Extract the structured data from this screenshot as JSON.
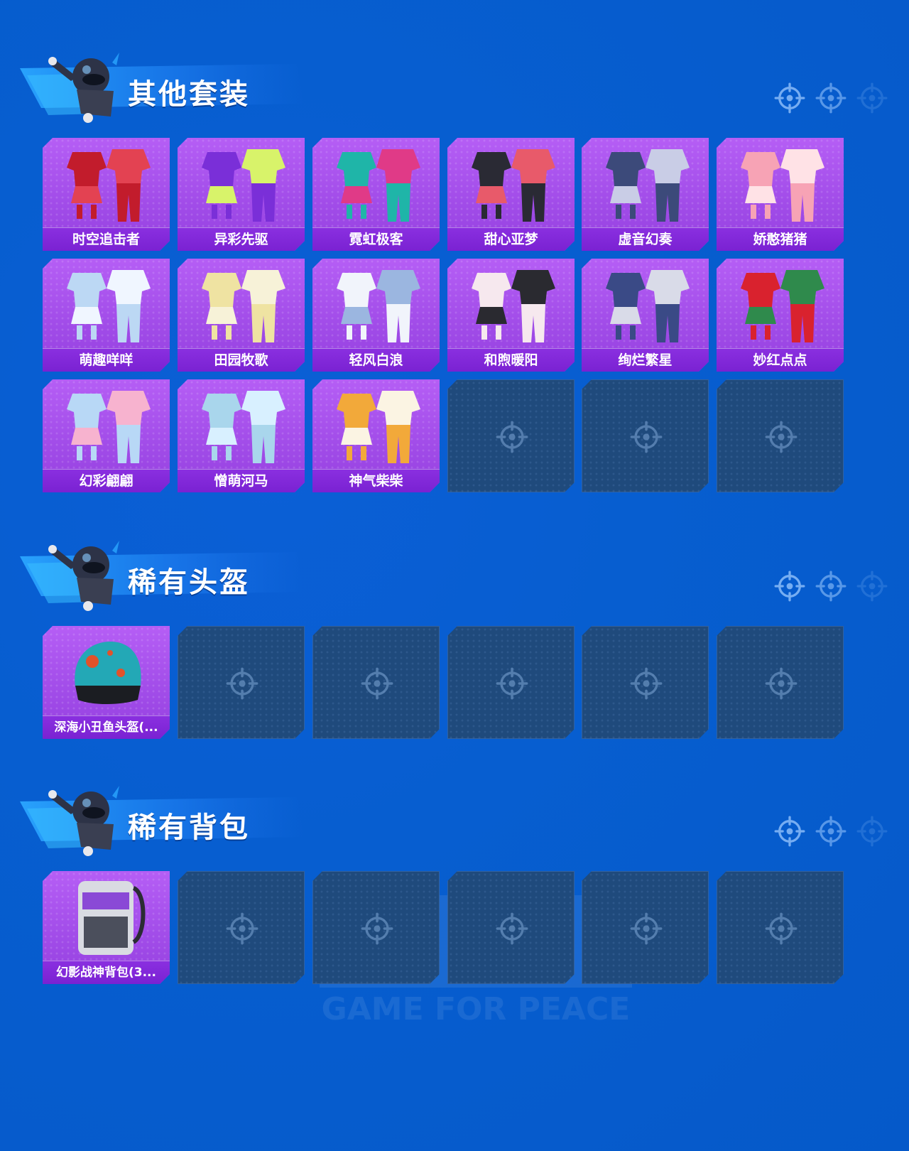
{
  "sections": [
    {
      "title": "其他套装",
      "items": [
        {
          "label": "时空追击者",
          "icon": "suit-outfit-icon",
          "colors": [
            "#c21c2c",
            "#e34252"
          ]
        },
        {
          "label": "异彩先驱",
          "icon": "suit-outfit-icon",
          "colors": [
            "#7a2fd8",
            "#d8f36a"
          ]
        },
        {
          "label": "霓虹极客",
          "icon": "suit-outfit-icon",
          "colors": [
            "#1fb5a8",
            "#e03a87"
          ]
        },
        {
          "label": "甜心亚梦",
          "icon": "suit-outfit-icon",
          "colors": [
            "#2a2a34",
            "#e85a6a"
          ]
        },
        {
          "label": "虚音幻奏",
          "icon": "suit-outfit-icon",
          "colors": [
            "#3c4a7a",
            "#c9cde6"
          ]
        },
        {
          "label": "娇憨猪猪",
          "icon": "suit-outfit-icon",
          "colors": [
            "#f7a3b5",
            "#ffe2e6"
          ]
        },
        {
          "label": "萌趣咩咩",
          "icon": "suit-outfit-icon",
          "colors": [
            "#bcd8f4",
            "#f0f6ff"
          ]
        },
        {
          "label": "田园牧歌",
          "icon": "suit-outfit-icon",
          "colors": [
            "#efe3a2",
            "#f7f2d8"
          ]
        },
        {
          "label": "轻风白浪",
          "icon": "suit-outfit-icon",
          "colors": [
            "#f1f4fb",
            "#9bb6e0"
          ]
        },
        {
          "label": "和煦暖阳",
          "icon": "suit-outfit-icon",
          "colors": [
            "#f6e8ee",
            "#2a2a30"
          ]
        },
        {
          "label": "绚烂繁星",
          "icon": "suit-outfit-icon",
          "colors": [
            "#3a4a86",
            "#d9dbe8"
          ]
        },
        {
          "label": "妙红点点",
          "icon": "suit-outfit-icon",
          "colors": [
            "#d9222e",
            "#2f8a4c"
          ]
        },
        {
          "label": "幻彩翩翩",
          "icon": "suit-outfit-icon",
          "colors": [
            "#b8d8f6",
            "#f7b3cf"
          ]
        },
        {
          "label": "憎萌河马",
          "icon": "suit-outfit-icon",
          "colors": [
            "#a9d6ec",
            "#d8f0ff"
          ]
        },
        {
          "label": "神气柴柴",
          "icon": "suit-outfit-icon",
          "colors": [
            "#f2a93a",
            "#fbf4e3"
          ]
        }
      ],
      "empty_slots": 3
    },
    {
      "title": "稀有头盔",
      "items": [
        {
          "label": "深海小丑鱼头盔(...",
          "icon": "helmet-icon",
          "colors": [
            "#23a8b6",
            "#e2522a"
          ]
        }
      ],
      "empty_slots": 5
    },
    {
      "title": "稀有背包",
      "items": [
        {
          "label": "幻影战神背包(3...",
          "icon": "backpack-icon",
          "colors": [
            "#d9dbe2",
            "#8a49d6"
          ]
        }
      ],
      "empty_slots": 5
    }
  ],
  "icons": {
    "banner_character": "skydiver-icon",
    "decor_reticle": "crosshair-icon",
    "empty_slot": "crosshair-icon",
    "watermark": "game-for-peace-logo"
  },
  "watermark_text": "GAME FOR PEACE",
  "colors": {
    "background": "#075ed0",
    "card_filled": "#a24de9",
    "card_label": "#7a22d2",
    "card_empty": "#1f4a7c"
  }
}
